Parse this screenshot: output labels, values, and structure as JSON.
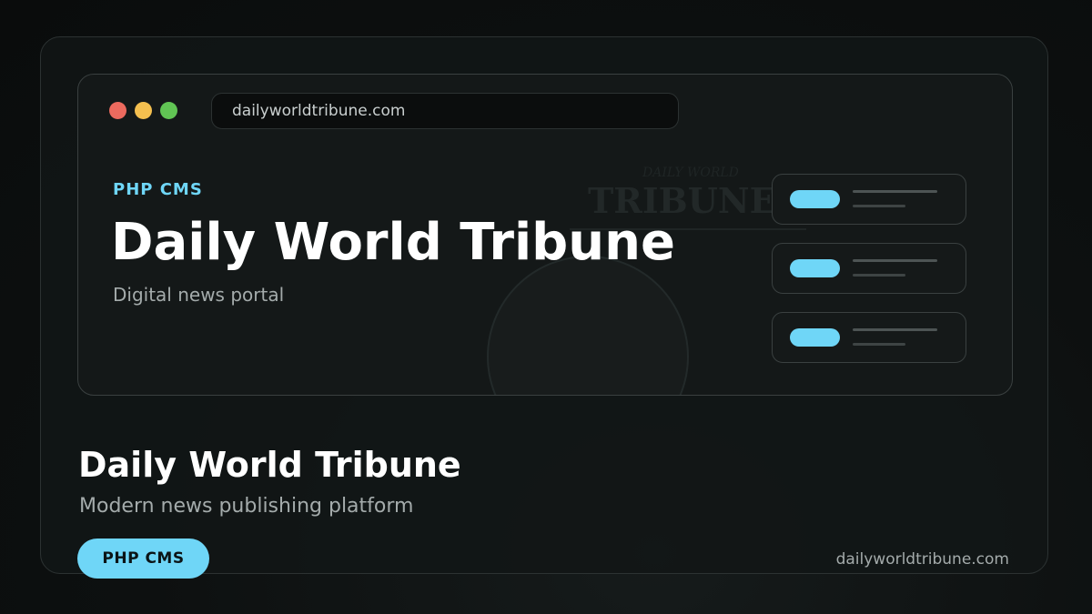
{
  "browser": {
    "window_controls": [
      {
        "name": "close",
        "color": "#ec6a5e"
      },
      {
        "name": "minimize",
        "color": "#f4bf4f"
      },
      {
        "name": "maximize",
        "color": "#61c554"
      }
    ],
    "url": "dailyworldtribune.com"
  },
  "hero": {
    "eyebrow": "PHP CMS",
    "title": "Daily World Tribune",
    "subtitle": "Digital news portal"
  },
  "mini_cards": [
    {
      "pill_color": "#6fd6f7"
    },
    {
      "pill_color": "#6fd6f7"
    },
    {
      "pill_color": "#6fd6f7"
    }
  ],
  "footer": {
    "title": "Daily World Tribune",
    "subtitle": "Modern news publishing platform",
    "badge": "PHP CMS",
    "url": "dailyworldtribune.com"
  },
  "colors": {
    "accent": "#6fd6f7",
    "background": "#0d1010",
    "text_primary": "#ffffff",
    "text_secondary": "#a4abab"
  }
}
